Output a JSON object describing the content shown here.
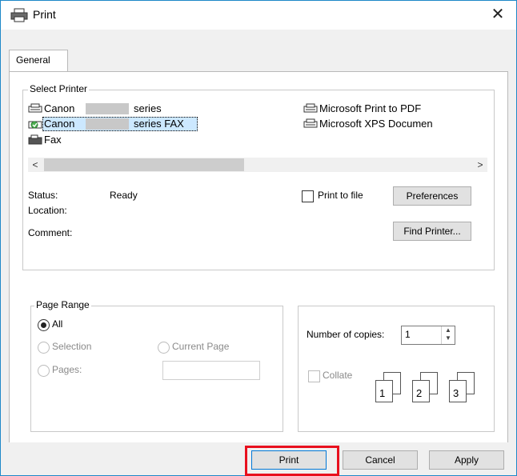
{
  "window": {
    "title": "Print",
    "close_glyph": "✕"
  },
  "tabs": [
    {
      "label": "General"
    }
  ],
  "select_printer": {
    "legend": "Select Printer",
    "printers": [
      {
        "name": "Canon",
        "suffix": "series",
        "icon": "printer-icon"
      },
      {
        "name": "Canon",
        "suffix": "series FAX",
        "icon": "fax-printer-icon",
        "selected": true
      },
      {
        "name": "Fax",
        "suffix": "",
        "icon": "fax-icon"
      },
      {
        "name": "Microsoft Print to PDF",
        "suffix": "",
        "icon": "printer-icon"
      },
      {
        "name": "Microsoft XPS Documen",
        "suffix": "",
        "icon": "printer-icon"
      }
    ],
    "scroll_left": "<",
    "scroll_right": ">",
    "status_label": "Status:",
    "status_value": "Ready",
    "location_label": "Location:",
    "comment_label": "Comment:",
    "print_to_file_label": "Print to file",
    "preferences_label": "Preferences",
    "find_printer_label": "Find Printer..."
  },
  "page_range": {
    "legend": "Page Range",
    "all_label": "All",
    "selection_label": "Selection",
    "current_page_label": "Current Page",
    "pages_label": "Pages:",
    "pages_value": ""
  },
  "copies": {
    "number_label": "Number of copies:",
    "number_value": "1",
    "collate_label": "Collate",
    "collate_pages": [
      "1",
      "1",
      "2",
      "2",
      "3",
      "3"
    ]
  },
  "buttons": {
    "print": "Print",
    "cancel": "Cancel",
    "apply": "Apply"
  },
  "colors": {
    "highlight": "#e8101e",
    "selection": "#cce8ff",
    "window_border": "#1e88c8"
  }
}
